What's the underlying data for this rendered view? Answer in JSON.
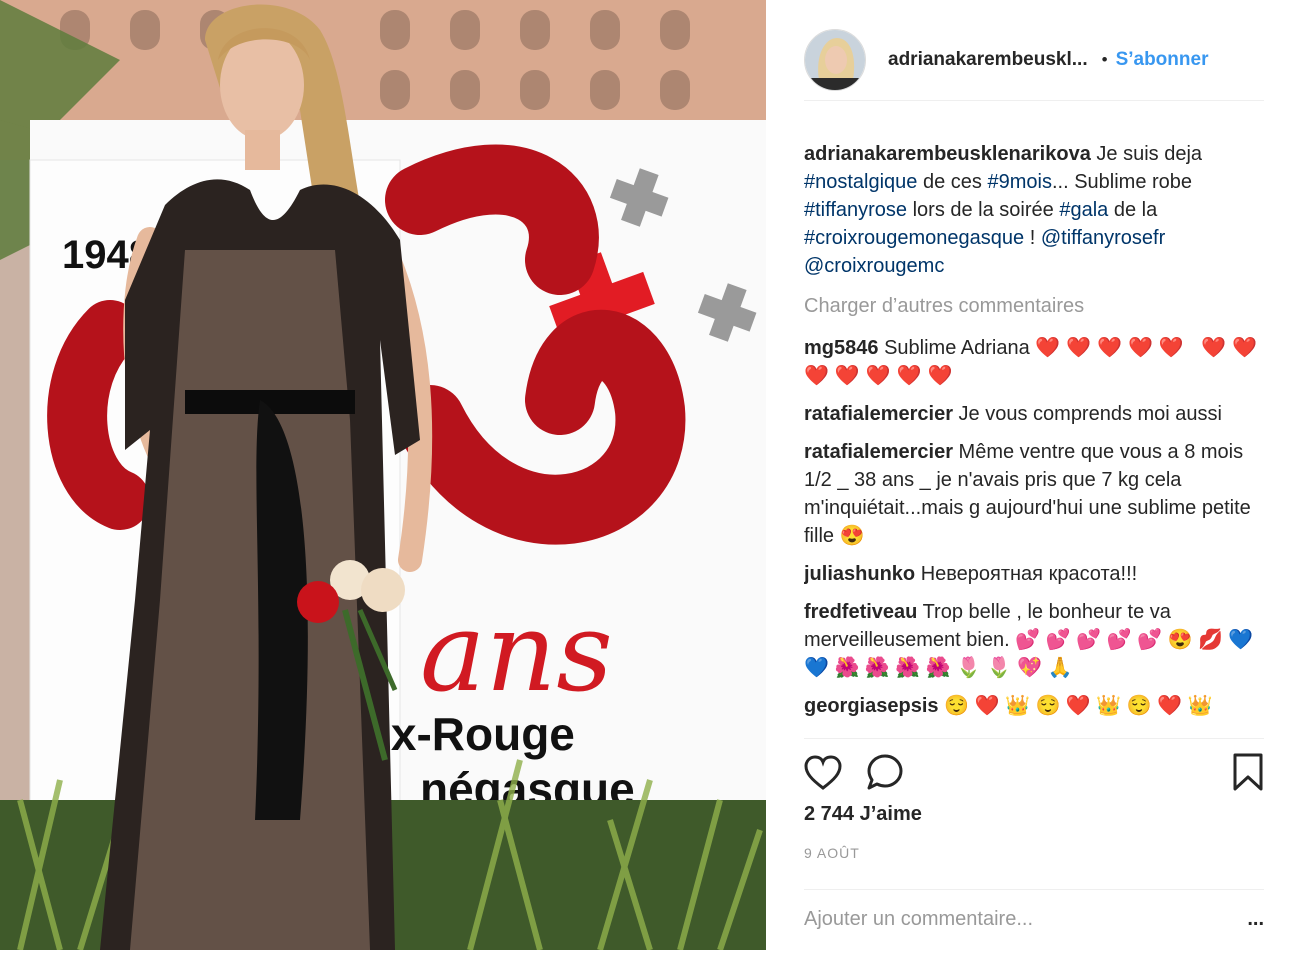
{
  "post": {
    "username_short": "adrianakarembeuskl...",
    "dot": "•",
    "follow_label": "S’abonner",
    "caption": {
      "username": "adrianakarembeusklenarikova",
      "t1": "Je suis deja",
      "h1": "#nostalgique",
      "t2": "de ces",
      "h2": "#9mois",
      "t3": "... Sublime robe",
      "h3": "#tiffanyrose",
      "t4": "lors de la soirée",
      "h4": "#gala",
      "t5": "de la",
      "h5": "#croixrougemonegasque",
      "t6": "!",
      "m1": "@tiffanyrosefr",
      "m2": "@croixrougemc"
    },
    "load_more": "Charger d’autres commentaires",
    "comments": [
      {
        "user": "mg5846",
        "text": "Sublime Adriana",
        "emoji": "❤️❤️❤️❤️❤️ ❤️❤️❤️❤️❤️❤️❤️"
      },
      {
        "user": "ratafialemercier",
        "text": "Je vous comprends moi aussi"
      },
      {
        "user": "ratafialemercier",
        "text": "Même ventre que vous a 8 mois 1/2 _ 38 ans _ je n'avais pris que 7 kg cela m'inquiétait...mais g aujourd'hui une sublime petite fille",
        "emoji": "😍"
      },
      {
        "user": "juliashunko",
        "text": "Невероятная красота!!!"
      },
      {
        "user": "fredfetiveau",
        "text": "Trop belle , le bonheur te va merveilleusement bien.",
        "emoji": "💕 💕 💕 💕 💕 😍 💋 💙 💙 🌺 🌺 🌺 🌺 🌷 🌷 💖 🙏"
      },
      {
        "user": "georgiasepsis",
        "text": "",
        "emoji": "😌 ❤️ 👑 😌 ❤️ 👑 😌 ❤️ 👑"
      }
    ],
    "likes": "2 744 J’aime",
    "date": "9 AOÛT",
    "add_comment_placeholder": "Ajouter un commentaire...",
    "more_options": "...",
    "icons": [
      "heart-icon",
      "comment-icon",
      "bookmark-icon"
    ]
  },
  "photo": {
    "sign_year": "1948",
    "sign_text1": "oix-Rouge",
    "sign_text2": "négasque",
    "sign_script": "ans"
  }
}
